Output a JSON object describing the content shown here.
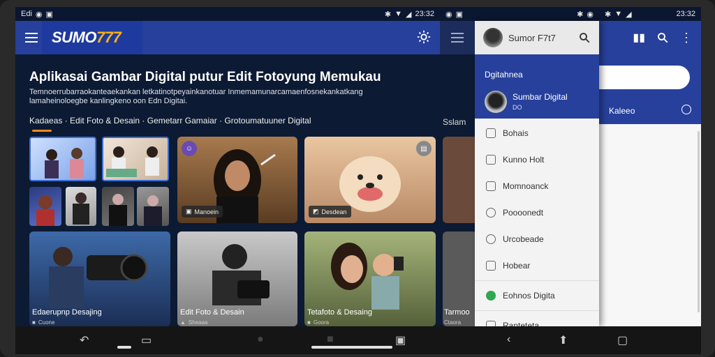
{
  "status": {
    "left_label": "Edi",
    "time_main": "23:32",
    "time_right": "23:32"
  },
  "appbar": {
    "logo_text": "SUMO",
    "logo_num": "777"
  },
  "main": {
    "title": "Aplikasai Gambar Digital putur Edit Fotoyung Memukau",
    "description": "Temnoerrubarraokanteaekankan letkatinotpeyainkanotuar Inmemamunarcamaenfosnekankatkang lamaheinoloegbe kanlingkeno oon Edn Digitai.",
    "categories": "Kadaeas · Edit Foto & Desain · Gemetarr Gamaiar · Grotoumatuuner Digital",
    "cards": [
      {
        "tag": "Manoein"
      },
      {
        "tag": "Desdean"
      },
      {
        "label": "Edaerupnp Desajing",
        "foot": "Cuone"
      },
      {
        "label": "Edit Foto & Desain",
        "foot": "Sheaaa"
      },
      {
        "label": "Tetafoto & Desaing",
        "foot": "Goora"
      }
    ]
  },
  "mid": {
    "label": "Sslam",
    "card_label": "Tarmoo",
    "foot": "Ctaora"
  },
  "drawer": {
    "header_name": "Sumor F7t7",
    "section": "Dgitahnea",
    "account_name": "Sumbar Digital",
    "account_sub": "DO",
    "items": [
      {
        "label": "Bohais"
      },
      {
        "label": "Kunno Holt"
      },
      {
        "label": "Momnoanck"
      },
      {
        "label": "Poooonedt"
      },
      {
        "label": "Urcobeade"
      },
      {
        "label": "Hobear"
      },
      {
        "label": "Eohnos Digita"
      },
      {
        "label": "Ranteteta"
      }
    ]
  },
  "right": {
    "tab_label": "Kaleeo"
  },
  "colors": {
    "primary": "#27409b",
    "accent": "#f7b21a",
    "underline": "#f28a1e",
    "background": "#0c1a33"
  }
}
